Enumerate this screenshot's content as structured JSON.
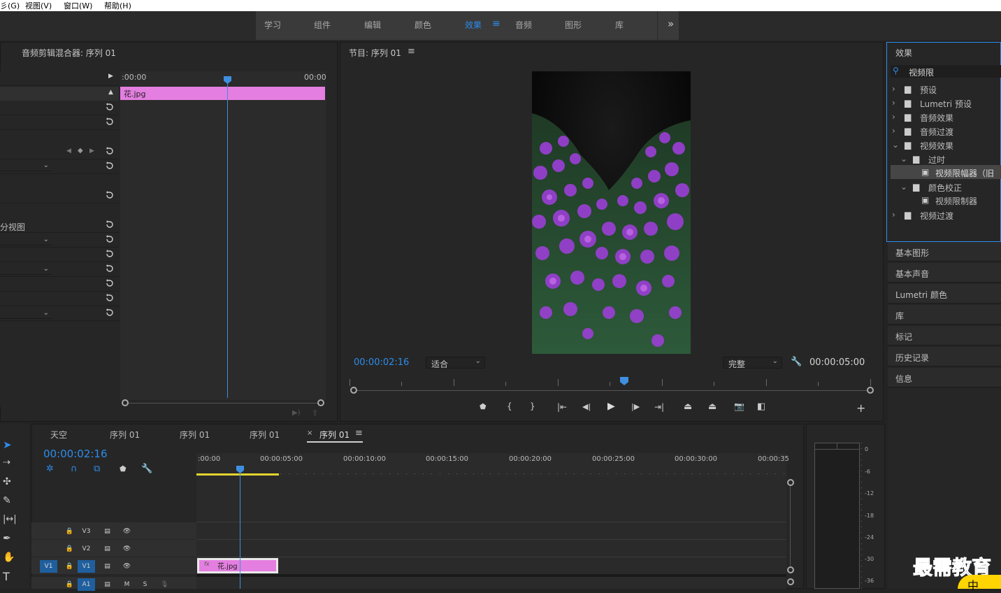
{
  "menubar": {
    "items": [
      "彡(G)",
      "视图(V)",
      "窗口(W)",
      "帮助(H)"
    ]
  },
  "workspaces": {
    "tabs": [
      "学习",
      "组件",
      "编辑",
      "颜色",
      "效果",
      "音频",
      "图形",
      "库"
    ],
    "active": "效果",
    "more": "»"
  },
  "mixer": {
    "title": "音频剪辑混合器: 序列 01",
    "time_start": ":00:00",
    "time_end": "00:00",
    "clip": "花.jpg",
    "split_view": "分视图"
  },
  "program": {
    "title": "节目: 序列 01",
    "timecode": "00:00:02:16",
    "fit": "适合",
    "quality": "完整",
    "duration": "00:00:05:00"
  },
  "effects": {
    "title": "效果",
    "search": "视频限",
    "tree": [
      {
        "label": "预设",
        "level": 0,
        "type": "preset"
      },
      {
        "label": "Lumetri 预设",
        "level": 0,
        "type": "preset"
      },
      {
        "label": "音频效果",
        "level": 0,
        "type": "folder"
      },
      {
        "label": "音频过渡",
        "level": 0,
        "type": "folder"
      },
      {
        "label": "视频效果",
        "level": 0,
        "type": "folder",
        "open": true
      },
      {
        "label": "过时",
        "level": 1,
        "type": "folder",
        "open": true
      },
      {
        "label": "视频限幅器（旧",
        "level": 2,
        "type": "effect",
        "selected": true
      },
      {
        "label": "颜色校正",
        "level": 1,
        "type": "folder",
        "open": true
      },
      {
        "label": "视频限制器",
        "level": 2,
        "type": "effect"
      },
      {
        "label": "视频过渡",
        "level": 0,
        "type": "folder"
      }
    ]
  },
  "sections": [
    "基本图形",
    "基本声音",
    "Lumetri 颜色",
    "库",
    "标记",
    "历史记录",
    "信息"
  ],
  "timeline": {
    "tabs": [
      "天空",
      "序列 01",
      "序列 01",
      "序列 01",
      "序列 01"
    ],
    "timecode": "00:00:02:16",
    "ruler": [
      ":00:00",
      "00:00:05:00",
      "00:00:10:00",
      "00:00:15:00",
      "00:00:20:00",
      "00:00:25:00",
      "00:00:30:00",
      "00:00:35"
    ],
    "tracks": [
      "V3",
      "V2",
      "V1",
      "A1"
    ],
    "source_patch": "V1",
    "clip": "花.jpg",
    "clip_fx": "fx",
    "a1_m": "M",
    "a1_s": "S"
  },
  "meter": {
    "labels": [
      "0",
      "-6",
      "-12",
      "-18",
      "-24",
      "-30",
      "-36"
    ]
  },
  "watermark": "最需教育",
  "ime": "中"
}
